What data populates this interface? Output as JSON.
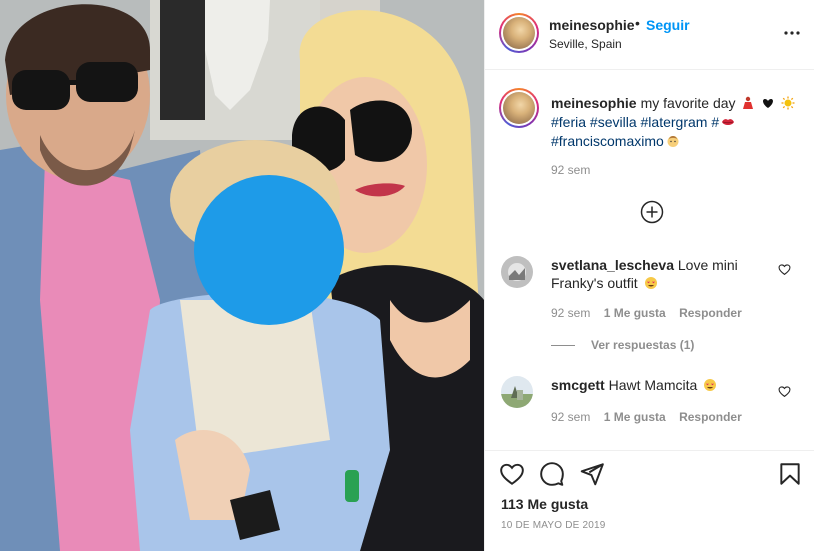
{
  "post": {
    "username": "meinesophie",
    "separator": "•",
    "follow_label": "Seguir",
    "location": "Seville, Spain"
  },
  "caption": {
    "username": "meinesophie",
    "text": "my favorite day",
    "emojis": [
      "woman-dancing-emoji",
      "heart-emoji",
      "sun-emoji"
    ],
    "hashtags_line1": [
      "#feria",
      "#sevilla",
      "#latergram",
      "#"
    ],
    "lips_emoji": "lips-emoji",
    "hashtag_line2": "#franciscomaximo",
    "baby_emoji": "baby-emoji",
    "time": "92 sem"
  },
  "comments": [
    {
      "username": "svetlana_lescheva",
      "text": "Love mini Franky's outfit",
      "emoji": "heart-eyes-emoji",
      "time": "92 sem",
      "likes": "1 Me gusta",
      "reply": "Responder",
      "view_replies": "Ver respuestas (1)"
    },
    {
      "username": "smcgett",
      "text": "Hawt Mamcita",
      "emoji": "heart-eyes-emoji",
      "time": "92 sem",
      "likes": "1 Me gusta",
      "reply": "Responder"
    }
  ],
  "footer": {
    "likes": "113 Me gusta",
    "date": "10 DE MAYO DE 2019"
  },
  "icons": {
    "more": "more-options-icon",
    "add_comment": "plus-circle-icon",
    "like": "heart-icon",
    "comment": "comment-bubble-icon",
    "share": "paper-plane-icon",
    "save": "bookmark-icon"
  },
  "colors": {
    "accent": "#0095f6",
    "hashtag": "#00376b",
    "muted": "#8e8e8e",
    "blur_circle": "#1e9be8"
  }
}
